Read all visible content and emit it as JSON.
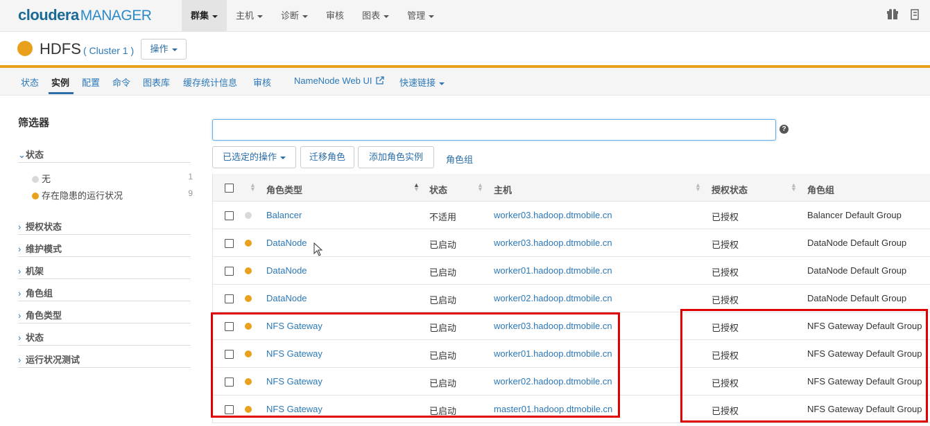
{
  "brand": {
    "name": "cloudera",
    "product": "MANAGER"
  },
  "nav": [
    {
      "label": "群集",
      "dropdown": true,
      "active": true
    },
    {
      "label": "主机",
      "dropdown": true
    },
    {
      "label": "诊断",
      "dropdown": true
    },
    {
      "label": "审核",
      "dropdown": false
    },
    {
      "label": "图表",
      "dropdown": true
    },
    {
      "label": "管理",
      "dropdown": true
    }
  ],
  "service": {
    "name": "HDFS",
    "cluster": "( Cluster 1 )",
    "actions_label": "操作",
    "status_color": "#e9a11b"
  },
  "subtabs": [
    "状态",
    "实例",
    "配置",
    "命令",
    "图表库",
    "缓存统计信息",
    "审核",
    "NameNode Web UI",
    "快速链接"
  ],
  "sidebar": {
    "title": "筛选器",
    "status_facet": "状态",
    "status_options": [
      {
        "label": "无",
        "count": "1",
        "color": "#d9d9d9"
      },
      {
        "label": "存在隐患的运行状况",
        "count": "9",
        "color": "#e9a11b"
      }
    ],
    "facets": [
      "授权状态",
      "维护模式",
      "机架",
      "角色组",
      "角色类型",
      "状态",
      "运行状况测试"
    ]
  },
  "toolbar": {
    "selected_actions": "已选定的操作",
    "migrate_roles": "迁移角色",
    "add_role_instances": "添加角色实例",
    "role_groups": "角色组"
  },
  "table": {
    "headers": {
      "type": "角色类型",
      "state": "状态",
      "host": "主机",
      "auth": "授权状态",
      "group": "角色组"
    },
    "rows": [
      {
        "type": "Balancer",
        "state": "不适用",
        "host": "worker03.hadoop.dtmobile.cn",
        "auth": "已授权",
        "group": "Balancer Default Group",
        "dot": "#d9d9d9"
      },
      {
        "type": "DataNode",
        "state": "已启动",
        "host": "worker03.hadoop.dtmobile.cn",
        "auth": "已授权",
        "group": "DataNode Default Group",
        "dot": "#e9a11b"
      },
      {
        "type": "DataNode",
        "state": "已启动",
        "host": "worker01.hadoop.dtmobile.cn",
        "auth": "已授权",
        "group": "DataNode Default Group",
        "dot": "#e9a11b"
      },
      {
        "type": "DataNode",
        "state": "已启动",
        "host": "worker02.hadoop.dtmobile.cn",
        "auth": "已授权",
        "group": "DataNode Default Group",
        "dot": "#e9a11b"
      },
      {
        "type": "NFS Gateway",
        "state": "已启动",
        "host": "worker03.hadoop.dtmobile.cn",
        "auth": "已授权",
        "group": "NFS Gateway Default Group",
        "dot": "#e9a11b"
      },
      {
        "type": "NFS Gateway",
        "state": "已启动",
        "host": "worker01.hadoop.dtmobile.cn",
        "auth": "已授权",
        "group": "NFS Gateway Default Group",
        "dot": "#e9a11b"
      },
      {
        "type": "NFS Gateway",
        "state": "已启动",
        "host": "worker02.hadoop.dtmobile.cn",
        "auth": "已授权",
        "group": "NFS Gateway Default Group",
        "dot": "#e9a11b"
      },
      {
        "type": "NFS Gateway",
        "state": "已启动",
        "host": "master01.hadoop.dtmobile.cn",
        "auth": "已授权",
        "group": "NFS Gateway Default Group",
        "dot": "#e9a11b"
      }
    ]
  },
  "colors": {
    "accent": "#2b78b8",
    "warning": "#e9a11b",
    "highlight": "#e00000"
  }
}
